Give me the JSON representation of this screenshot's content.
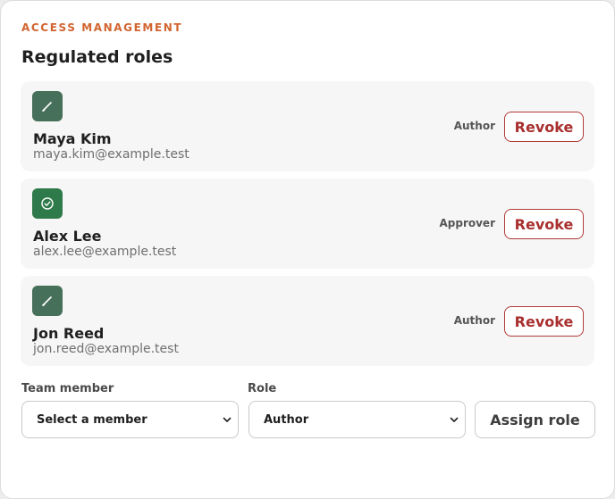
{
  "header": {
    "eyebrow": "ACCESS MANAGEMENT",
    "title": "Regulated roles"
  },
  "assignments": [
    {
      "name": "Maya Kim",
      "email": "maya.kim@example.test",
      "role": "Author",
      "icon": "pen-icon",
      "action": "Revoke"
    },
    {
      "name": "Alex Lee",
      "email": "alex.lee@example.test",
      "role": "Approver",
      "icon": "check-circle-icon",
      "action": "Revoke"
    },
    {
      "name": "Jon Reed",
      "email": "jon.reed@example.test",
      "role": "Author",
      "icon": "pen-icon",
      "action": "Revoke"
    }
  ],
  "form": {
    "member_label": "Team member",
    "member_value": "Select a member",
    "role_label": "Role",
    "role_value": "Author",
    "assign_label": "Assign role"
  },
  "colors": {
    "accent": "#d2642f",
    "author_icon": "#46705a",
    "approver_icon": "#2f7a4a",
    "revoke": "#a8302e"
  }
}
